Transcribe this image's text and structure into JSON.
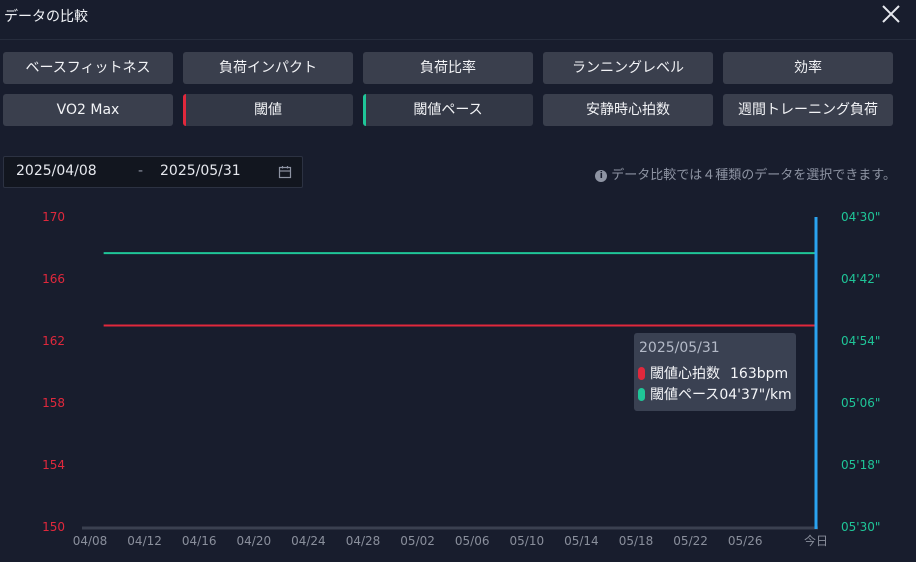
{
  "dialog": {
    "title": "データの比較",
    "close_icon": "close-icon"
  },
  "metrics": [
    {
      "label": "ベースフィットネス",
      "selected": false,
      "color": ""
    },
    {
      "label": "負荷インパクト",
      "selected": false,
      "color": ""
    },
    {
      "label": "負荷比率",
      "selected": false,
      "color": ""
    },
    {
      "label": "ランニングレベル",
      "selected": false,
      "color": ""
    },
    {
      "label": "効率",
      "selected": false,
      "color": ""
    },
    {
      "label": "VO2 Max",
      "selected": false,
      "color": ""
    },
    {
      "label": "閾値",
      "selected": true,
      "color": "#e0283c"
    },
    {
      "label": "閾値ペース",
      "selected": true,
      "color": "#1fc598"
    },
    {
      "label": "安静時心拍数",
      "selected": false,
      "color": ""
    },
    {
      "label": "週間トレーニング負荷",
      "selected": false,
      "color": ""
    }
  ],
  "date_range": {
    "start": "2025/04/08",
    "separator": "-",
    "end": "2025/05/31",
    "icon": "calendar-icon"
  },
  "info": {
    "icon": "info-icon",
    "text": "データ比較では４種類のデータを選択できます。"
  },
  "tooltip": {
    "date": "2025/05/31",
    "rows": [
      {
        "label": "閾値心拍数",
        "value": "163bpm",
        "color": "#e0283c"
      },
      {
        "label": "閾値ペース",
        "value": "04'37\"/km",
        "color": "#1fc598"
      }
    ]
  },
  "chart_data": {
    "type": "line",
    "x_ticks": [
      "04/08",
      "04/12",
      "04/16",
      "04/20",
      "04/24",
      "04/28",
      "05/02",
      "05/06",
      "05/10",
      "05/14",
      "05/18",
      "05/22",
      "05/26",
      "今日"
    ],
    "left_axis": {
      "ticks": [
        "170",
        "166",
        "162",
        "158",
        "154",
        "150"
      ],
      "ylim": [
        150,
        170
      ],
      "color": "#e0283c"
    },
    "right_axis": {
      "ticks": [
        "04'30\"",
        "04'42\"",
        "04'54\"",
        "05'06\"",
        "05'18\"",
        "05'30\""
      ],
      "ylim_seconds_per_km": [
        270,
        330
      ],
      "color": "#1fc598"
    },
    "series": [
      {
        "name": "閾値心拍数",
        "axis": "left",
        "color": "#e0283c",
        "x": [
          "04/09",
          "05/31"
        ],
        "y": [
          163,
          163
        ]
      },
      {
        "name": "閾値ペース",
        "axis": "right",
        "color": "#1fc598",
        "x": [
          "04/09",
          "05/31"
        ],
        "y": [
          "04'37\"",
          "04'37\""
        ]
      }
    ],
    "cursor": {
      "x": "05/31",
      "color": "#2aa3f0"
    },
    "grid": false
  }
}
